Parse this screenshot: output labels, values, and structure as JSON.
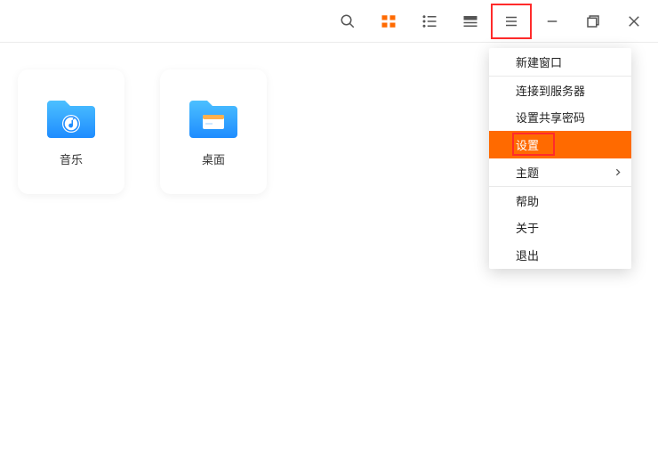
{
  "toolbar": {
    "search_icon": "search-icon",
    "grid_icon": "grid-view-icon",
    "list_icon": "list-view-icon",
    "compact_icon": "compact-view-icon",
    "menu_icon": "hamburger-menu-icon",
    "minimize_icon": "minimize-icon",
    "maximize_icon": "maximize-icon",
    "close_icon": "close-icon"
  },
  "files": [
    {
      "label": "音乐",
      "icon": "music-folder"
    },
    {
      "label": "桌面",
      "icon": "desktop-folder"
    }
  ],
  "menu": {
    "new_window": "新建窗口",
    "connect_server": "连接到服务器",
    "set_share_password": "设置共享密码",
    "settings": "设置",
    "theme": "主题",
    "help": "帮助",
    "about": "关于",
    "exit": "退出"
  },
  "colors": {
    "accent": "#ff6a00",
    "highlight_border": "#ff2b2b",
    "folder_blue_top": "#2aa7ff",
    "folder_blue_bottom": "#1e8cff"
  }
}
